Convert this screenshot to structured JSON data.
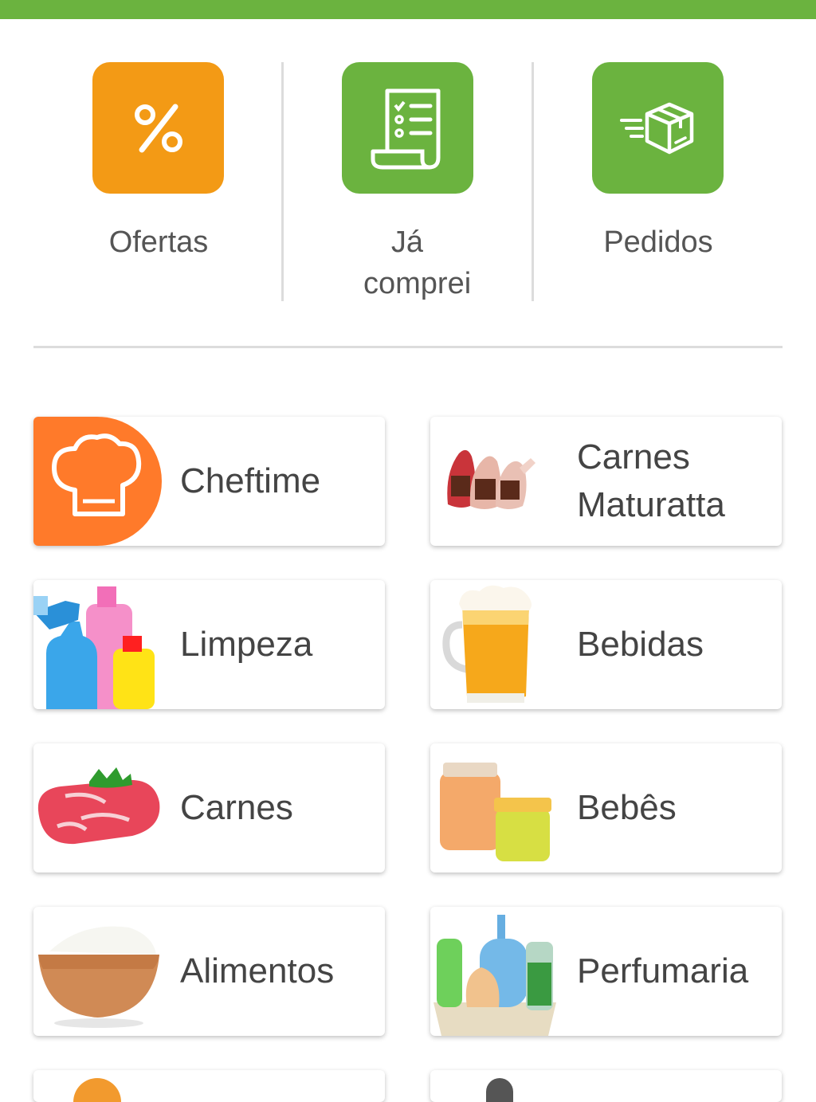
{
  "colors": {
    "brand_green": "#6bb33f",
    "offers_orange": "#f39a15",
    "cheftime_orange": "#ff7a2a"
  },
  "shortcuts": [
    {
      "label": "Ofertas",
      "icon": "percent-icon"
    },
    {
      "label": "Já comprei",
      "icon": "receipt-list-icon"
    },
    {
      "label": "Pedidos",
      "icon": "delivery-box-icon"
    }
  ],
  "categories": [
    {
      "label": "Cheftime",
      "icon": "chef-hat-icon"
    },
    {
      "label": "Carnes Maturatta",
      "icon": "cured-meat-image"
    },
    {
      "label": "Limpeza",
      "icon": "cleaning-bottles-image"
    },
    {
      "label": "Bebidas",
      "icon": "beer-mug-image"
    },
    {
      "label": "Carnes",
      "icon": "steak-image"
    },
    {
      "label": "Bebês",
      "icon": "baby-food-jars-image"
    },
    {
      "label": "Alimentos",
      "icon": "rice-bowl-image"
    },
    {
      "label": "Perfumaria",
      "icon": "toiletries-basket-image"
    }
  ]
}
